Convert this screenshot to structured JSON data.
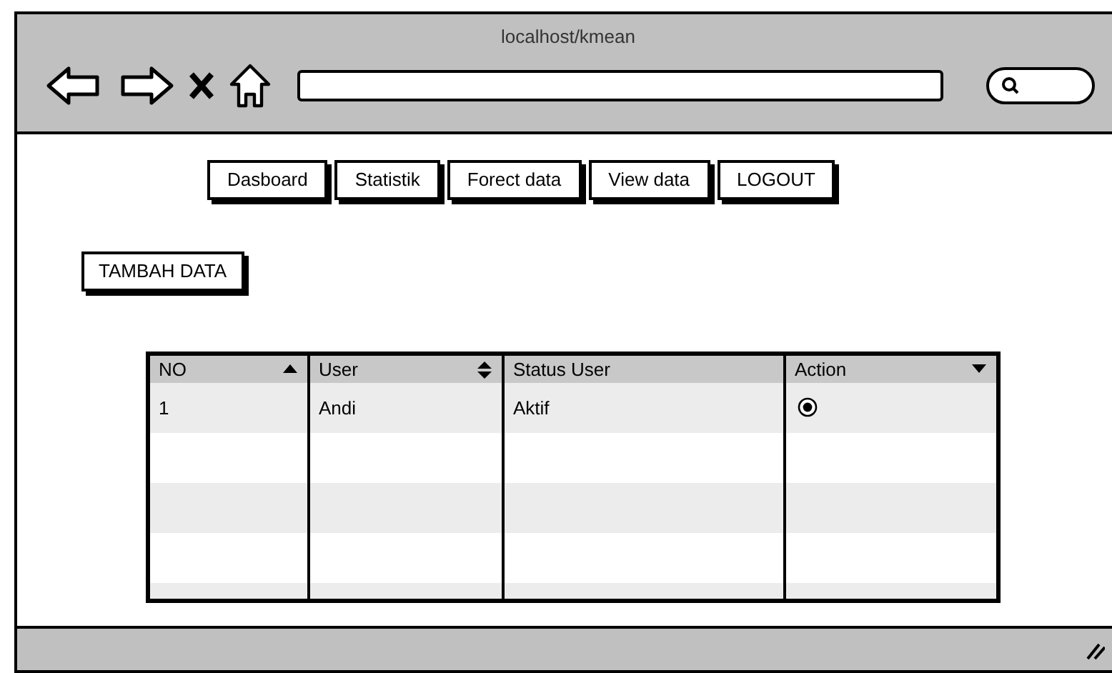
{
  "window": {
    "title": "localhost/kmean"
  },
  "nav": [
    {
      "label": "Dasboard"
    },
    {
      "label": "Statistik"
    },
    {
      "label": "Forect data"
    },
    {
      "label": "View data"
    },
    {
      "label": "LOGOUT"
    }
  ],
  "add_button": {
    "label": "TAMBAH DATA"
  },
  "table": {
    "columns": [
      {
        "label": "NO",
        "kind": "ascending"
      },
      {
        "label": "User",
        "kind": "sortable"
      },
      {
        "label": "Status User",
        "kind": "plain"
      },
      {
        "label": "Action",
        "kind": "descending"
      }
    ],
    "rows": [
      {
        "cells": [
          "1",
          "Andi",
          "Aktif"
        ],
        "action": {
          "kind": "radio",
          "selected": true
        }
      }
    ]
  }
}
